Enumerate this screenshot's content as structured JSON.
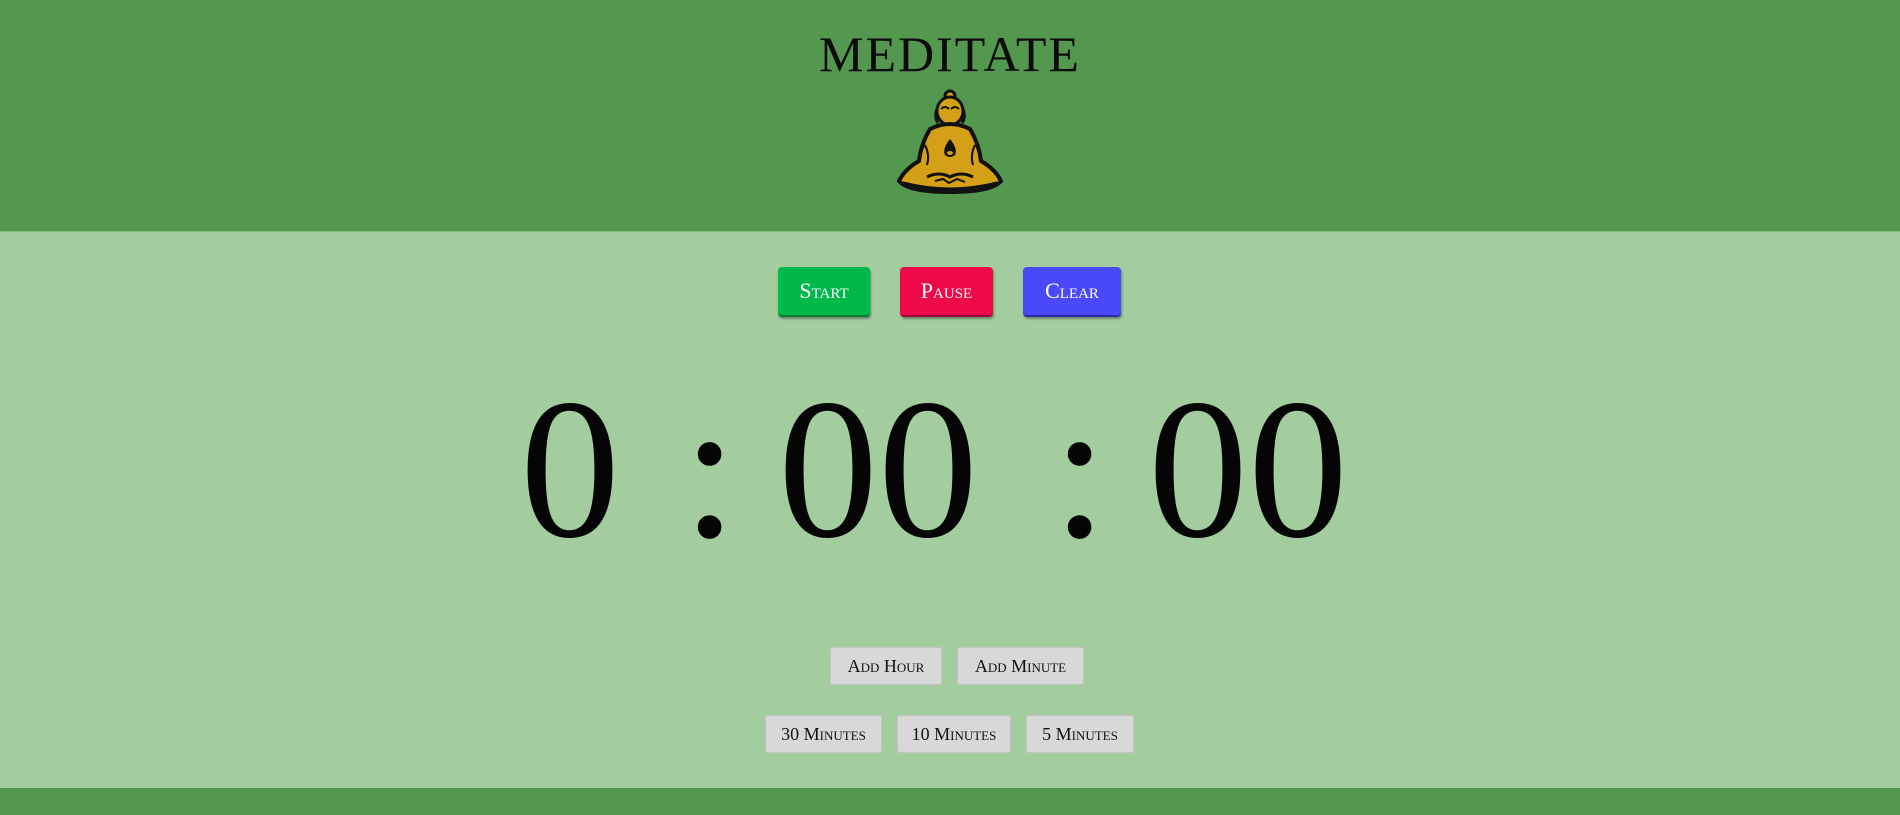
{
  "header": {
    "title": "MEDITATE",
    "logo_icon": "seated-buddha-icon",
    "background": "#549850"
  },
  "controls": {
    "start_label": "Start",
    "pause_label": "Pause",
    "clear_label": "Clear",
    "start_color": "#00b94a",
    "pause_color": "#ee0a49",
    "clear_color": "#4949f7"
  },
  "timer": {
    "hours": "0",
    "minutes": "00",
    "seconds": "00",
    "separator": ":"
  },
  "adjust": {
    "add_hour_label": "Add Hour",
    "add_minute_label": "Add Minute"
  },
  "presets": {
    "thirty_label": "30 Minutes",
    "ten_label": "10 Minutes",
    "five_label": "5 Minutes"
  },
  "theme": {
    "main_background": "#a3cd9f",
    "button_gray": "#d8d8d8"
  }
}
